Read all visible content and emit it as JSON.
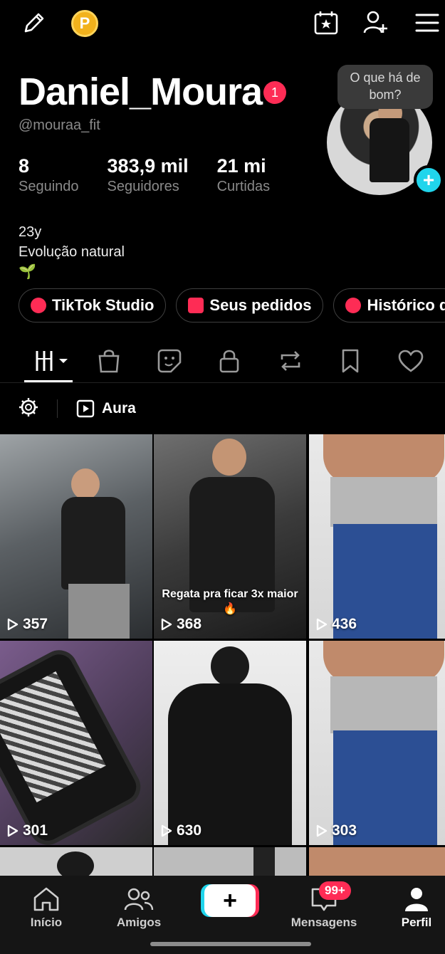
{
  "topbar": {
    "coin_label": "P"
  },
  "profile": {
    "display_name": "Daniel_Moura",
    "notification_count": "1",
    "handle": "@mouraa_fit",
    "bubble_text": "O que há de bom?",
    "stats": [
      {
        "value": "8",
        "label": "Seguindo"
      },
      {
        "value": "383,9 mil",
        "label": "Seguidores"
      },
      {
        "value": "21 mi",
        "label": "Curtidas"
      }
    ],
    "bio": [
      "23y",
      "Evolução natural",
      "🌱"
    ]
  },
  "chips": [
    {
      "label": "TikTok Studio"
    },
    {
      "label": "Seus pedidos"
    },
    {
      "label": "Histórico d"
    }
  ],
  "tabs": [
    "videos",
    "shop",
    "stickers",
    "private",
    "reposts",
    "saved",
    "liked"
  ],
  "subrow": {
    "playlist_label": "Aura"
  },
  "videos": [
    {
      "views": "357",
      "caption": ""
    },
    {
      "views": "368",
      "caption": "Regata pra ficar 3x maior 🔥"
    },
    {
      "views": "436",
      "caption": ""
    },
    {
      "views": "301",
      "caption": ""
    },
    {
      "views": "630",
      "caption": ""
    },
    {
      "views": "303",
      "caption": ""
    }
  ],
  "bottom_nav": {
    "home": "Início",
    "friends": "Amigos",
    "create": "+",
    "inbox": "Mensagens",
    "inbox_badge": "99+",
    "profile": "Perfil"
  },
  "colors": {
    "accent_red": "#fe2c55",
    "accent_cyan": "#20d5ec",
    "coin": "#f2b21c"
  }
}
